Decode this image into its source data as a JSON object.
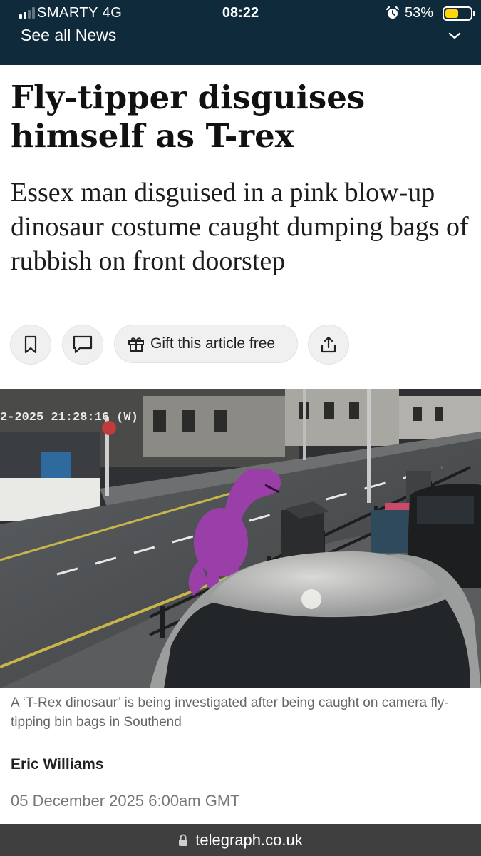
{
  "status_bar": {
    "carrier": "SMARTY  4G",
    "time": "08:22",
    "battery": "53%",
    "battery_level": 0.53,
    "alarm_icon": "alarm-clock-icon"
  },
  "news_menu": {
    "label": "See all News",
    "icon": "chevron-down-icon"
  },
  "article": {
    "headline": "Fly-tipper disguises himself as T-rex",
    "standfirst": "Essex man disguised in a pink blow-up dinosaur costume caught dumping bags of rubbish on front doorstep",
    "actions": {
      "bookmark_icon": "bookmark-icon",
      "comment_icon": "comment-icon",
      "gift_label": "Gift this article free",
      "gift_icon": "gift-icon",
      "share_icon": "share-icon"
    },
    "photo": {
      "timestamp_overlay": "2-2025 21:28:16 (W)",
      "subject": "CCTV still of person in inflatable pink T-rex costume beside wheelie bins on a street at night"
    },
    "caption": "A ‘T-Rex dinosaur’ is being investigated after being caught on camera fly-tipping bin bags in Southend",
    "author": "Eric Williams",
    "date": "05 December 2025 6:00am GMT"
  },
  "browser": {
    "url": "telegraph.co.uk",
    "lock_icon": "lock-icon"
  },
  "colors": {
    "top_bar": "#0f2a3b",
    "battery_fill": "#ffd60a",
    "url_bar": "#3f3f3f",
    "dino": "#9b3fa8"
  }
}
